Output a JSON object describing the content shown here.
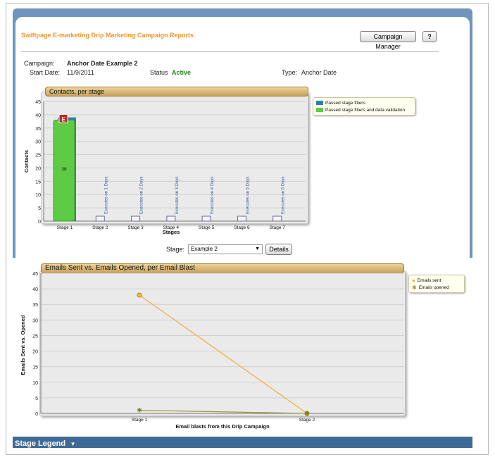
{
  "header": {
    "title": "Swiftpage E-marketing Drip Marketing Campaign Reports",
    "campaign_manager_label": "Campaign Manager",
    "help_label": "?"
  },
  "campaign": {
    "campaign_label": "Campaign:",
    "campaign_name": "Anchor Date Example 2",
    "start_label": "Start Date:",
    "start_value": "11/9/2011",
    "status_label": "Status",
    "status_value": "Active",
    "type_label": "Type:",
    "type_value": "Anchor Date"
  },
  "contacts_chart": {
    "title": "Contacts, per stage",
    "legend": [
      "Passed stage filters",
      "Passed stage filters and data validation"
    ],
    "xlabel": "Stages",
    "ylabel": "Contacts",
    "bar_value_label": "38",
    "stage_icon_letter": "E"
  },
  "stage_select": {
    "label": "Stage:",
    "value": "Example 2",
    "details_label": "Details"
  },
  "emails_chart": {
    "title": "Emails Sent vs. Emails Opened, per Email Blast",
    "legend": [
      "Emails sent",
      "Emails opened"
    ],
    "xlabel": "Email blasts from this Drip Campaign",
    "ylabel": "Emails Sent vs. Opened"
  },
  "stage_legend": {
    "label": "Stage Legend"
  },
  "colors": {
    "accent_orange": "#f0932a",
    "header_blue": "#6f95bd",
    "status_green": "#1a8a1a",
    "bar_green": "#5ecb45",
    "bar_blue": "#2f7db8",
    "sent_line": "#f0b030",
    "opened_line": "#9a9a3a"
  },
  "chart_data": [
    {
      "type": "bar",
      "title": "Contacts, per stage",
      "xlabel": "Stages",
      "ylabel": "Contacts",
      "ylim": [
        0,
        45
      ],
      "yticks": [
        0,
        5,
        10,
        15,
        20,
        25,
        30,
        35,
        40,
        45
      ],
      "categories": [
        "Stage 1",
        "Stage 2",
        "Stage 3",
        "Stage 4",
        "Stage 5",
        "Stage 6",
        "Stage 7"
      ],
      "series": [
        {
          "name": "Passed stage filters",
          "values": [
            39,
            0,
            0,
            0,
            0,
            0,
            0
          ]
        },
        {
          "name": "Passed stage filters and data validation",
          "values": [
            38,
            0,
            0,
            0,
            0,
            0,
            0
          ]
        }
      ],
      "annotations": [
        "",
        "Executes on 1 Days",
        "Executes on 2 Days",
        "Executes on 3 Days",
        "Executes on 4 Days",
        "Executes on 5 Days",
        "Executes on 6 Days"
      ],
      "legend_position": "top-right"
    },
    {
      "type": "line",
      "title": "Emails Sent vs. Emails Opened, per Email Blast",
      "xlabel": "Email blasts from this Drip Campaign",
      "ylabel": "Emails Sent vs. Opened",
      "ylim": [
        0,
        45
      ],
      "yticks": [
        0,
        5,
        10,
        15,
        20,
        25,
        30,
        35,
        40,
        45
      ],
      "categories": [
        "Stage 1",
        "Stage 2"
      ],
      "series": [
        {
          "name": "Emails sent",
          "values": [
            38,
            0
          ]
        },
        {
          "name": "Emails opened",
          "values": [
            1,
            0
          ]
        }
      ],
      "legend_position": "top-right"
    }
  ]
}
